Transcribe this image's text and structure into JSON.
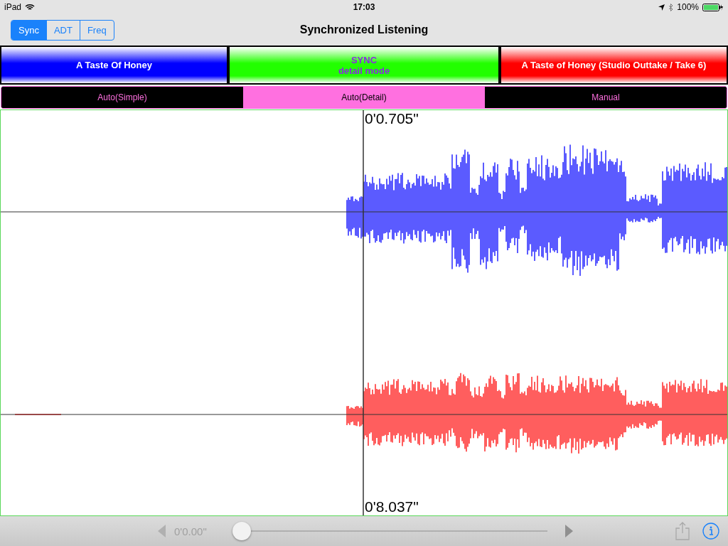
{
  "status_bar": {
    "device": "iPad",
    "time": "17:03",
    "battery": "100%"
  },
  "nav": {
    "segments": [
      {
        "label": "Sync",
        "selected": true
      },
      {
        "label": "ADT",
        "selected": false
      },
      {
        "label": "Freq",
        "selected": false
      }
    ],
    "title": "Synchronized Listening"
  },
  "tracks": [
    {
      "kind": "track",
      "color": "#0000ff",
      "lines": [
        "A Taste Of Honey"
      ]
    },
    {
      "kind": "sync",
      "color": "#22ff00",
      "lines": [
        "SYNC",
        "detail mode"
      ]
    },
    {
      "kind": "track",
      "color": "#ff0000",
      "lines": [
        "A Taste of Honey (Studio Outtake / Take 6)"
      ]
    }
  ],
  "modes": [
    {
      "label": "Auto(Simple)",
      "selected": false
    },
    {
      "label": "Auto(Detail)",
      "selected": true
    },
    {
      "label": "Manual",
      "selected": false
    }
  ],
  "waveform": {
    "top_time": "0'0.705\"",
    "bottom_time": "0'8.037\""
  },
  "toolbar": {
    "time": "0'0.00\"",
    "level": 0
  }
}
